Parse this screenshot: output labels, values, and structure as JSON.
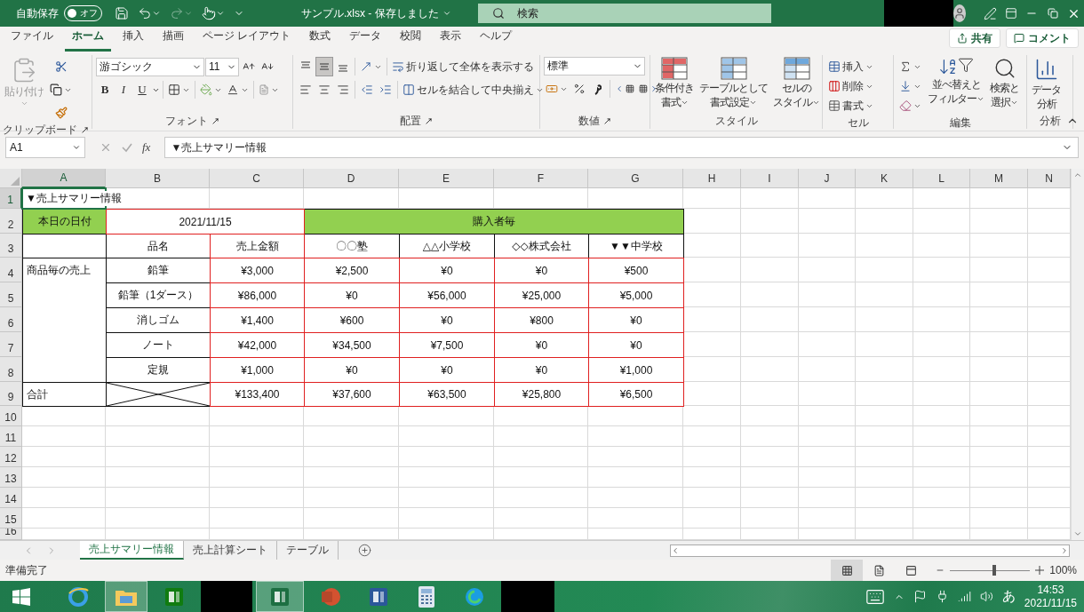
{
  "title_bar": {
    "autosave_label": "自動保存",
    "autosave": {
      "label": "オフ",
      "on": false
    },
    "document_title": "サンプル.xlsx - 保存しました",
    "search_placeholder": "検索"
  },
  "menu_tabs": [
    {
      "label": "ファイル",
      "selected": false
    },
    {
      "label": "ホーム",
      "selected": true
    },
    {
      "label": "挿入",
      "selected": false
    },
    {
      "label": "描画",
      "selected": false
    },
    {
      "label": "ページ レイアウト",
      "selected": false
    },
    {
      "label": "数式",
      "selected": false
    },
    {
      "label": "データ",
      "selected": false
    },
    {
      "label": "校閲",
      "selected": false
    },
    {
      "label": "表示",
      "selected": false
    },
    {
      "label": "ヘルプ",
      "selected": false
    }
  ],
  "share_button": "共有",
  "comment_button": "コメント",
  "ribbon": {
    "clipboard": {
      "paste": {
        "label": "貼り付け",
        "disabled": true
      },
      "group_label": "クリップボード"
    },
    "font": {
      "font_name": "游ゴシック",
      "font_size": "11",
      "style_buttons": [
        "B",
        "I",
        "U"
      ],
      "group_label": "フォント"
    },
    "alignment": {
      "vertical_align": [
        {
          "selected": false
        },
        {
          "selected": true
        },
        {
          "selected": false
        }
      ],
      "wrap_text": "折り返して全体を表示する",
      "merge_center": "セルを結合して中央揃え",
      "group_label": "配置"
    },
    "number": {
      "format": "標準",
      "group_label": "数値"
    },
    "styles": {
      "buttons": [
        {
          "lines": [
            "条件付き",
            "書式"
          ]
        },
        {
          "lines": [
            "テーブルとして",
            "書式設定"
          ]
        },
        {
          "lines": [
            "セルの",
            "スタイル"
          ]
        }
      ],
      "group_label": "スタイル"
    },
    "cells": {
      "buttons": [
        "挿入",
        "削除",
        "書式"
      ],
      "group_label": "セル"
    },
    "editing": {
      "buttons": [
        {
          "lines": [
            "並べ替えと",
            "フィルター"
          ]
        },
        {
          "lines": [
            "検索と",
            "選択"
          ]
        }
      ],
      "group_label": "編集"
    },
    "analysis": {
      "lines": [
        "データ",
        "分析"
      ],
      "group_label": "分析"
    }
  },
  "formula_bar": {
    "name_box": "A1",
    "function_label": "fx",
    "formula": "▼売上サマリー情報"
  },
  "sheet": {
    "columns": [
      {
        "label": "A",
        "selected": true
      },
      {
        "label": "B",
        "selected": false
      },
      {
        "label": "C",
        "selected": false
      },
      {
        "label": "D",
        "selected": false
      },
      {
        "label": "E",
        "selected": false
      },
      {
        "label": "F",
        "selected": false
      },
      {
        "label": "G",
        "selected": false
      },
      {
        "label": "H",
        "selected": false
      },
      {
        "label": "I",
        "selected": false
      },
      {
        "label": "J",
        "selected": false
      },
      {
        "label": "K",
        "selected": false
      },
      {
        "label": "L",
        "selected": false
      },
      {
        "label": "M",
        "selected": false
      },
      {
        "label": "N",
        "selected": false
      }
    ],
    "rows": [
      {
        "label": "1",
        "selected": true,
        "kind": "title",
        "cells": [
          "▼売上サマリー情報"
        ]
      },
      {
        "label": "2",
        "selected": false,
        "kind": "date-header",
        "cells": [
          "本日の日付",
          "2021/11/15",
          "購入者毎"
        ]
      },
      {
        "label": "3",
        "selected": false,
        "kind": "column-header",
        "cells": [
          null,
          "品名",
          "売上金額",
          "〇〇塾",
          "△△小学校",
          "◇◇株式会社",
          "▼▼中学校"
        ]
      },
      {
        "label": "4",
        "selected": false,
        "kind": "data",
        "cells": [
          "商品毎の売上",
          "鉛筆",
          "¥3,000",
          "¥2,500",
          "¥0",
          "¥0",
          "¥500"
        ]
      },
      {
        "label": "5",
        "selected": false,
        "kind": "data",
        "cells": [
          null,
          "鉛筆（1ダース）",
          "¥86,000",
          "¥0",
          "¥56,000",
          "¥25,000",
          "¥5,000"
        ]
      },
      {
        "label": "6",
        "selected": false,
        "kind": "data",
        "cells": [
          null,
          "消しゴム",
          "¥1,400",
          "¥600",
          "¥0",
          "¥800",
          "¥0"
        ]
      },
      {
        "label": "7",
        "selected": false,
        "kind": "data",
        "cells": [
          null,
          "ノート",
          "¥42,000",
          "¥34,500",
          "¥7,500",
          "¥0",
          "¥0"
        ]
      },
      {
        "label": "8",
        "selected": false,
        "kind": "data",
        "cells": [
          null,
          "定規",
          "¥1,000",
          "¥0",
          "¥0",
          "¥0",
          "¥1,000"
        ]
      },
      {
        "label": "9",
        "selected": false,
        "kind": "total",
        "cells": [
          "合計",
          null,
          "¥133,400",
          "¥37,600",
          "¥63,500",
          "¥25,800",
          "¥6,500"
        ]
      },
      {
        "label": "10",
        "selected": false,
        "kind": "blank"
      },
      {
        "label": "11",
        "selected": false,
        "kind": "blank"
      },
      {
        "label": "12",
        "selected": false,
        "kind": "blank"
      },
      {
        "label": "13",
        "selected": false,
        "kind": "blank"
      },
      {
        "label": "14",
        "selected": false,
        "kind": "blank"
      },
      {
        "label": "15",
        "selected": false,
        "kind": "blank"
      },
      {
        "label": "16",
        "selected": false,
        "kind": "blank"
      }
    ]
  },
  "sheet_tabs": [
    {
      "label": "売上サマリー情報",
      "selected": true
    },
    {
      "label": "売上計算シート",
      "selected": false
    },
    {
      "label": "テーブル",
      "selected": false
    }
  ],
  "status_bar": {
    "status": "準備完了",
    "views": [
      {
        "selected": true
      },
      {
        "selected": false
      },
      {
        "selected": false
      }
    ],
    "zoom": {
      "level": 0.55,
      "label": "100%"
    }
  },
  "taskbar": {
    "ime": "あ",
    "time": "14:53",
    "date": "2021/11/15"
  }
}
